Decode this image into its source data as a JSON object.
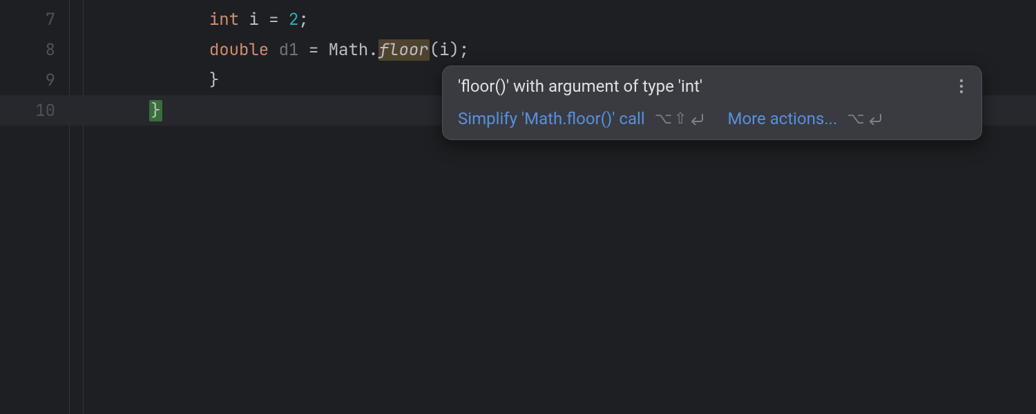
{
  "editor": {
    "lines": [
      {
        "num": "7",
        "indent": "            ",
        "tokens": [
          {
            "t": "int ",
            "c": "kw"
          },
          {
            "t": "i ",
            "c": "var"
          },
          {
            "t": "= ",
            "c": "punc"
          },
          {
            "t": "2",
            "c": "num"
          },
          {
            "t": ";",
            "c": "punc"
          }
        ]
      },
      {
        "num": "8",
        "indent": "            ",
        "tokens": [
          {
            "t": "double ",
            "c": "kw"
          },
          {
            "t": "d1 ",
            "c": "gray"
          },
          {
            "t": "= ",
            "c": "punc"
          },
          {
            "t": "Math",
            "c": "mth"
          },
          {
            "t": ".",
            "c": "punc"
          },
          {
            "t": "floor",
            "c": "call",
            "hl": true
          },
          {
            "t": "(",
            "c": "punc"
          },
          {
            "t": "i",
            "c": "var"
          },
          {
            "t": ")",
            "c": "punc"
          },
          {
            "t": ";",
            "c": "punc"
          }
        ]
      },
      {
        "num": "9",
        "indent": "            ",
        "tokens": [
          {
            "t": "}",
            "c": "punc"
          }
        ]
      },
      {
        "num": "10",
        "indent": "      ",
        "tokens": [
          {
            "t": "}",
            "c": "brace-match"
          }
        ],
        "current": true
      }
    ]
  },
  "tooltip": {
    "title": "'floor()' with argument of type 'int'",
    "primary_action": "Simplify 'Math.floor()' call",
    "primary_shortcut": "⌥⇧↵",
    "more_actions": "More actions...",
    "more_shortcut": "⌥↵"
  }
}
